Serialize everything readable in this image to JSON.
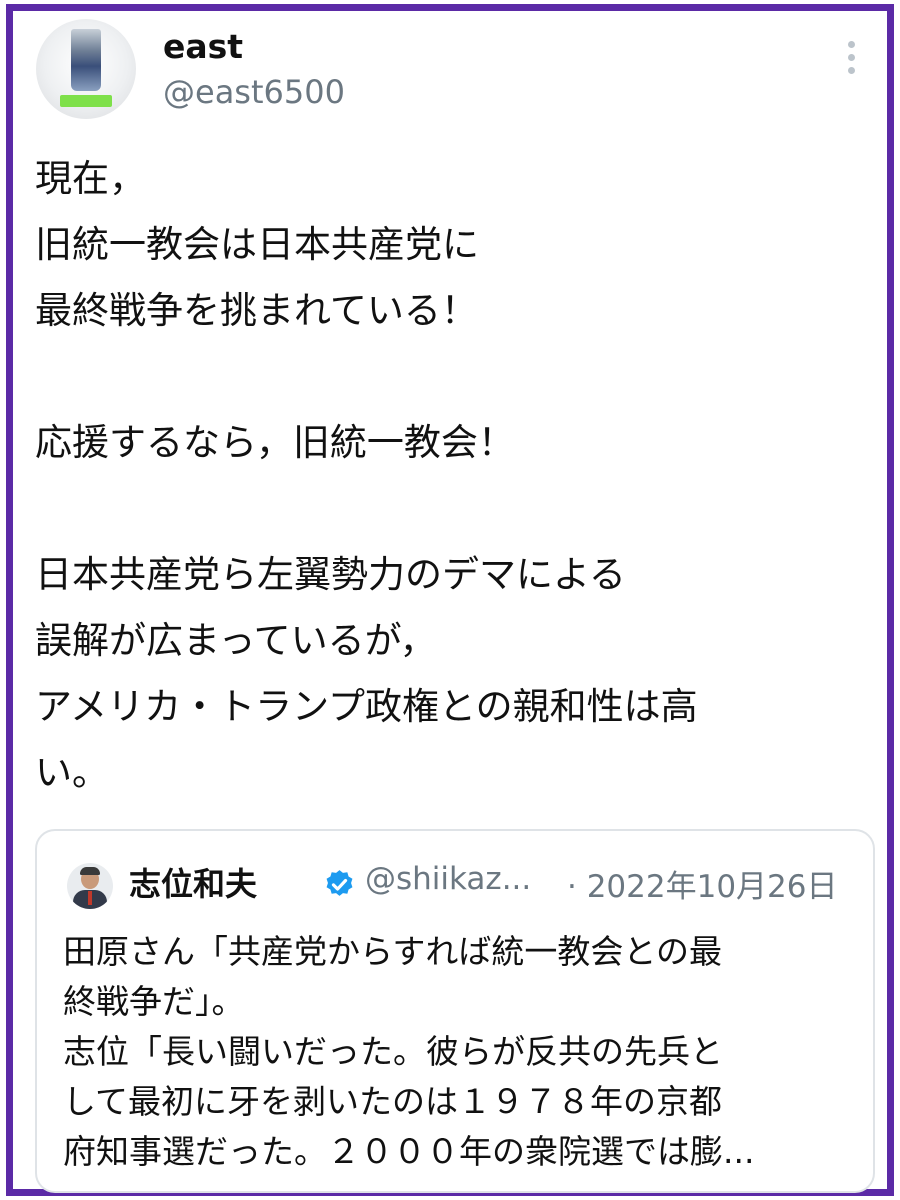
{
  "author": {
    "name": "east",
    "handle": "@east6500",
    "avatar_icon": "drink-cup-avatar"
  },
  "menu_icon": "more-vertical-icon",
  "tweet": {
    "lines": [
      "現在，",
      "旧統一教会は日本共産党に",
      "最終戦争を挑まれている！",
      "",
      "応援するなら，旧統一教会！",
      "",
      "日本共産党ら左翼勢力のデマによる",
      "誤解が広まっているが，",
      "アメリカ・トランプ政権との親和性は高",
      "い。"
    ]
  },
  "quote": {
    "name": "志位和夫",
    "verified_icon": "verified-badge-icon",
    "handle": "@shiikaz...",
    "date": "· 2022年10月26日",
    "lines": [
      "田原さん「共産党からすれば統一教会との最",
      "終戦争だ」。",
      "志位「長い闘いだった。彼らが反共の先兵と",
      "して最初に牙を剥いたのは１９７８年の京都",
      "府知事選だった。２０００年の衆院選では膨..."
    ]
  },
  "colors": {
    "frame": "#5b2aa6",
    "verified": "#1d9bf0",
    "secondary_text": "#6b7781"
  }
}
